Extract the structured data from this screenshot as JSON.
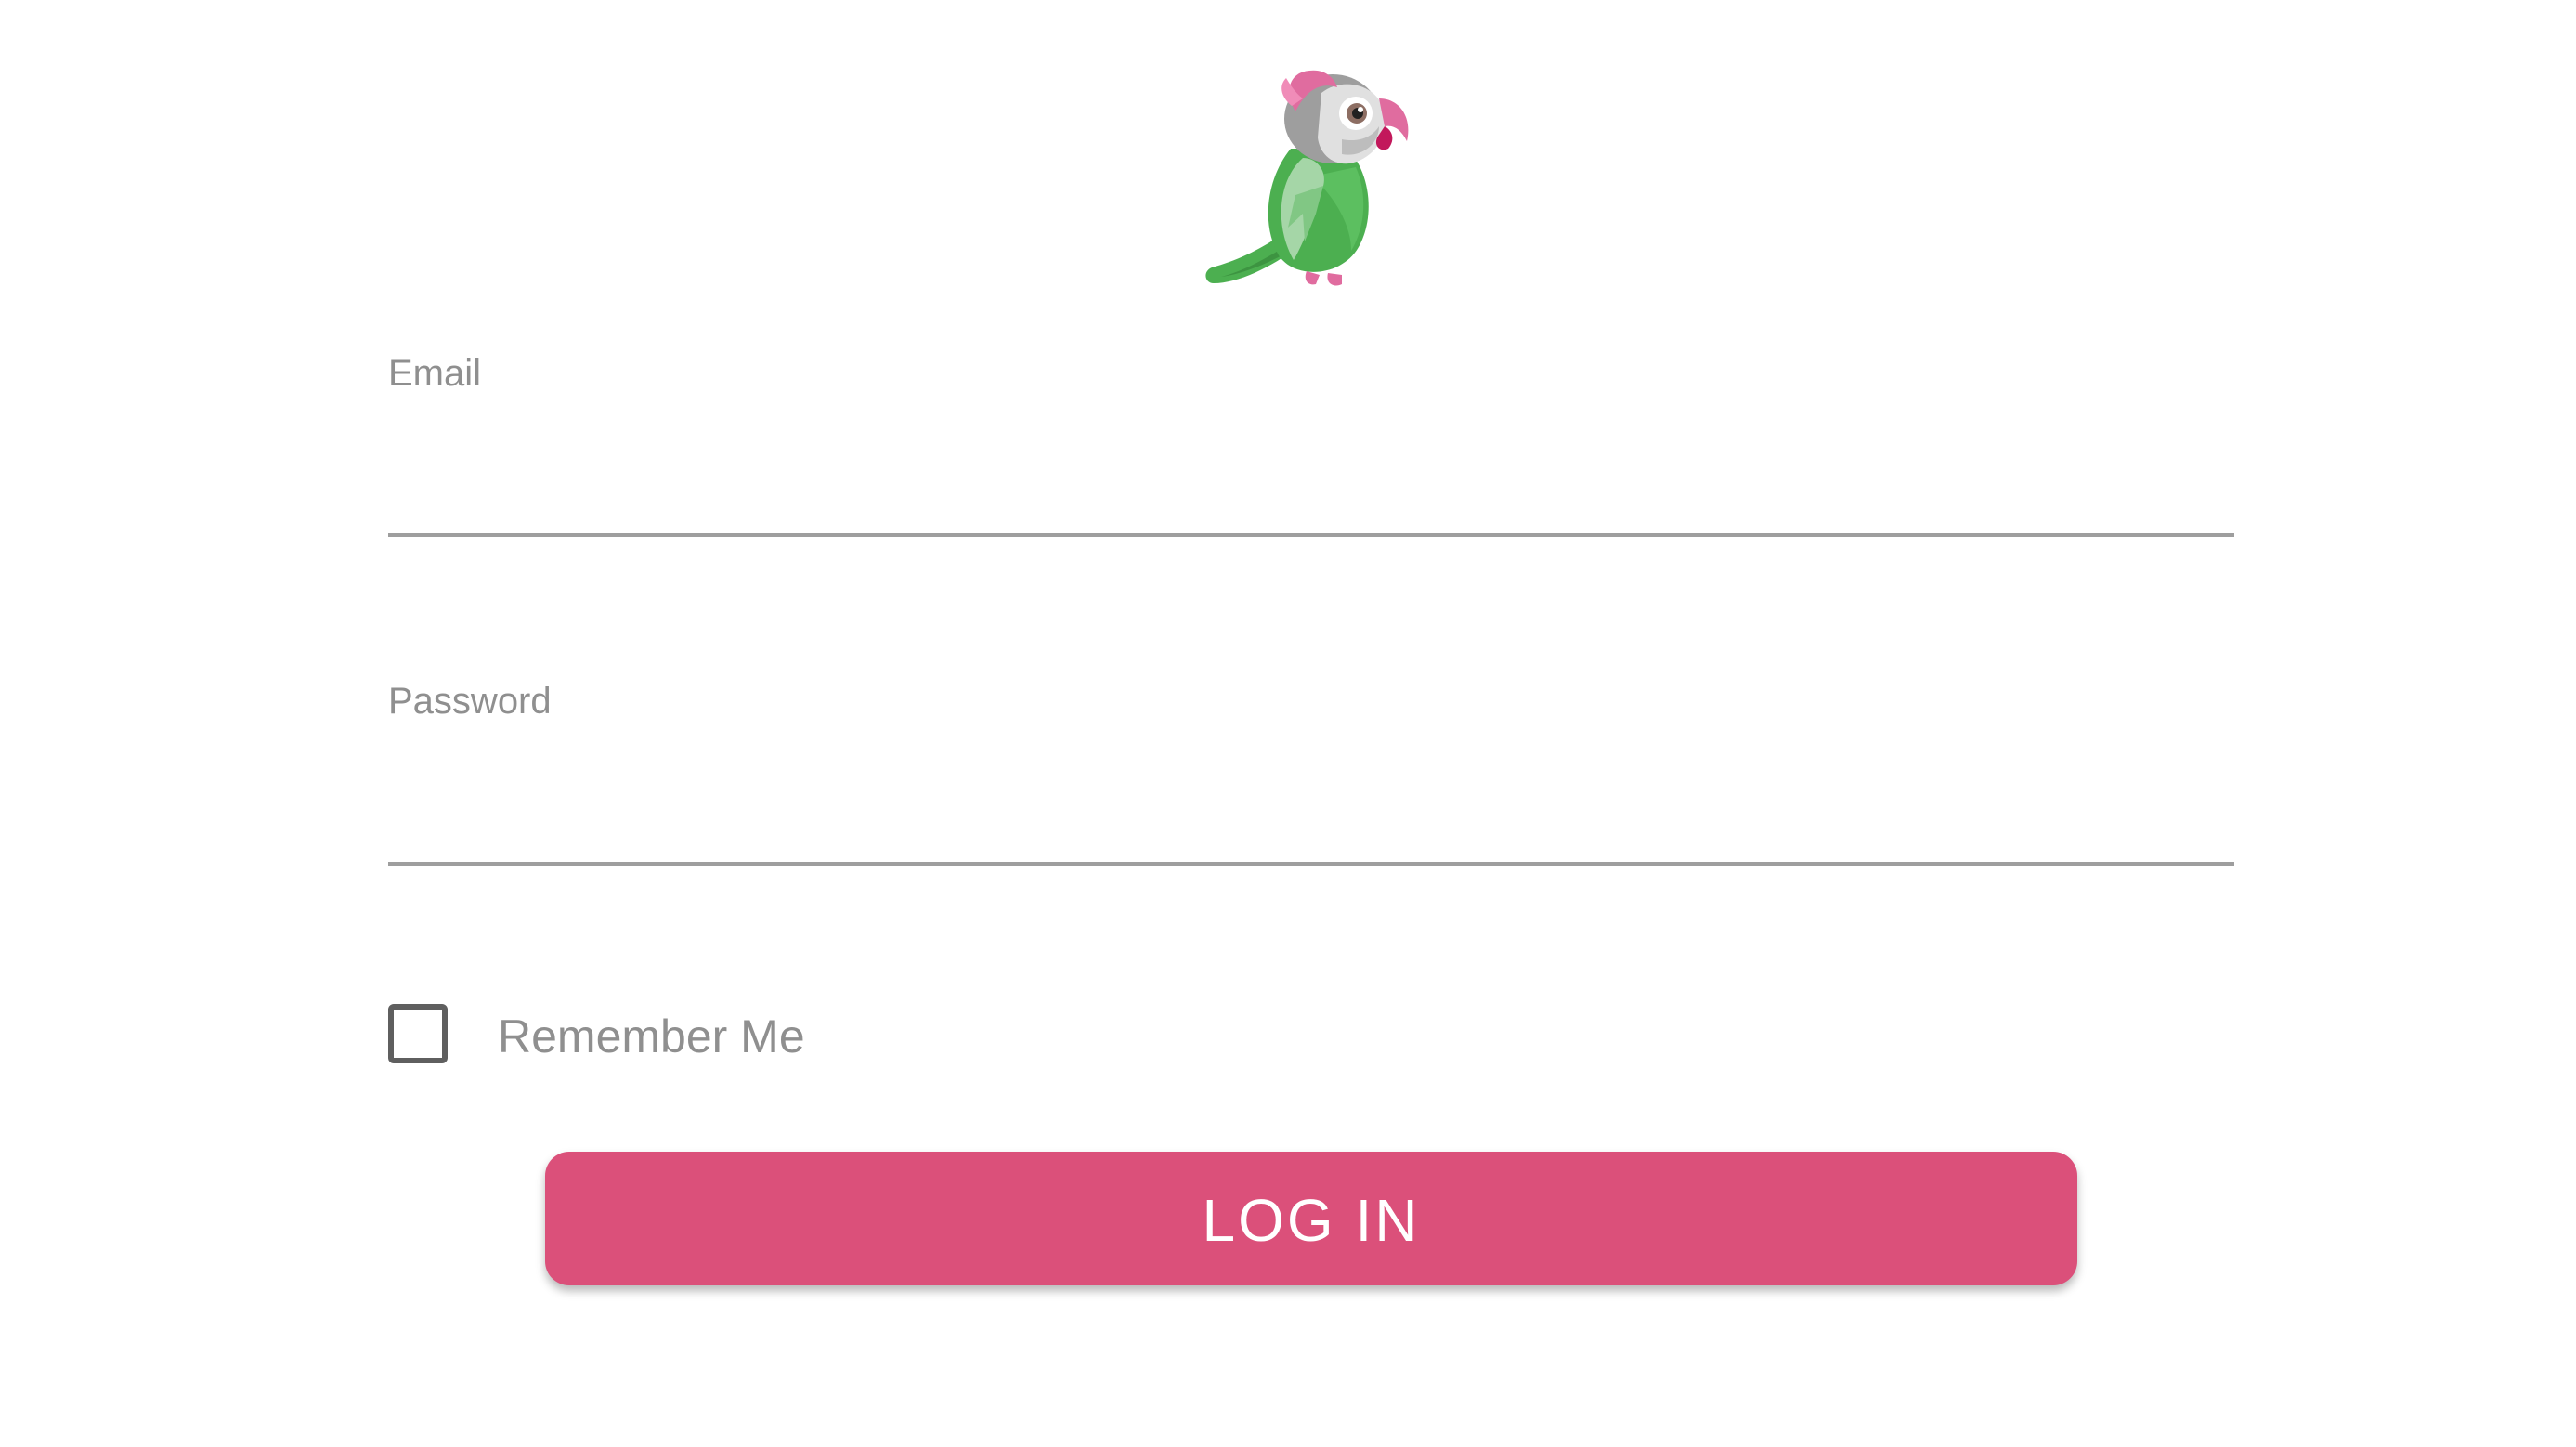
{
  "logo": {
    "icon": "parrot-logo-icon"
  },
  "form": {
    "email_label": "Email",
    "email_value": "",
    "password_label": "Password",
    "password_value": "",
    "remember_label": "Remember Me",
    "remember_checked": false,
    "login_label": "LOG IN"
  },
  "colors": {
    "accent": "#db507a",
    "label_text": "#8f8f8f",
    "underline": "#9e9e9e",
    "checkbox_border": "#5f5f5f",
    "background": "#ffffff"
  }
}
